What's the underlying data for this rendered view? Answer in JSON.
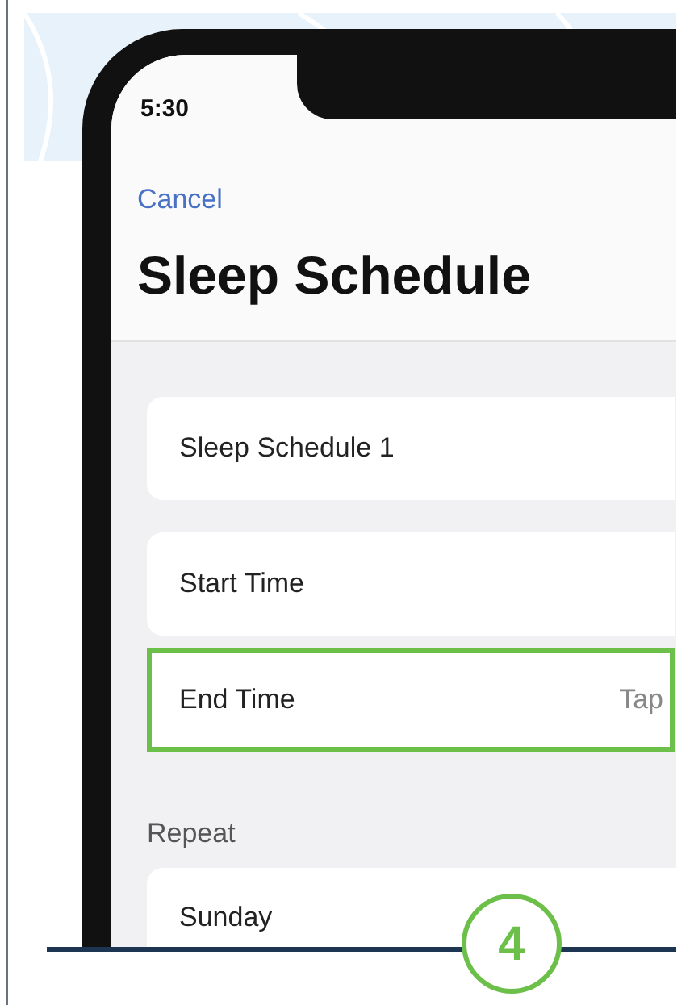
{
  "status_bar": {
    "time": "5:30"
  },
  "nav": {
    "cancel": "Cancel",
    "title": "Sleep Schedule"
  },
  "rows": [
    {
      "label": "Sleep Schedule 1",
      "selected": false
    },
    {
      "label": "Start Time",
      "selected": false
    },
    {
      "label": "End Time",
      "value": "Tap",
      "selected": true
    }
  ],
  "repeat": {
    "heading": "Repeat",
    "days": [
      "Sunday"
    ]
  },
  "step_badge": "4"
}
